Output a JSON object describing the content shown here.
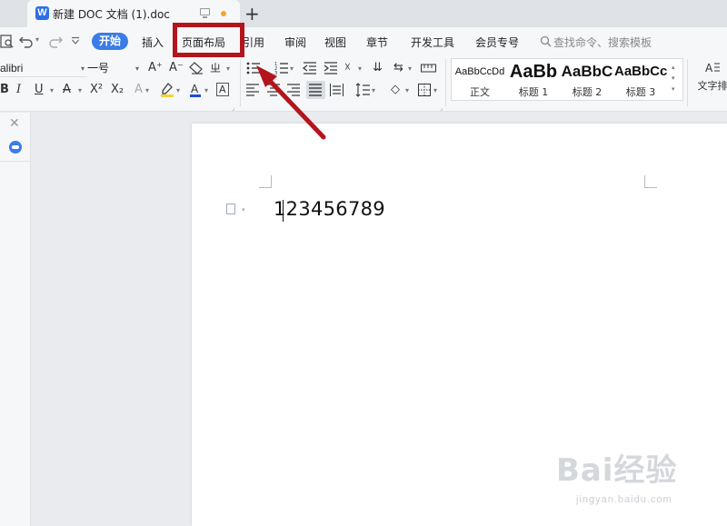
{
  "tab": {
    "icon_letter": "W",
    "title": "新建 DOC 文档 (1).doc",
    "new_tab": "+"
  },
  "menu": {
    "items": [
      "开始",
      "插入",
      "页面布局",
      "引用",
      "审阅",
      "视图",
      "章节",
      "开发工具",
      "会员专号"
    ],
    "more": "›",
    "search_placeholder": "查找命令、搜索模板"
  },
  "toolbar": {
    "font_name": "alibri",
    "font_size": "一号",
    "styles": [
      {
        "sample": "AaBbCcDd",
        "name": "正文"
      },
      {
        "sample": "AaBb",
        "name": "标题 1"
      },
      {
        "sample": "AaBbC",
        "name": "标题 2"
      },
      {
        "sample": "AaBbCc",
        "name": "标题 3"
      }
    ],
    "text_layout": "文字排"
  },
  "document": {
    "body_text": "123456789"
  },
  "annotation": {
    "highlight_color": "#b3151c"
  },
  "watermark": {
    "logo": "Bai经验",
    "url": "jingyan.baidu.com"
  },
  "colors": {
    "accent": "#3b7ce8",
    "font_color_bar": "#1d4fd8",
    "highlight_bar": "#f3d23a"
  }
}
